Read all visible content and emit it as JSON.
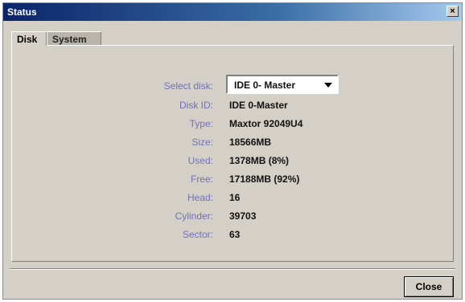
{
  "window": {
    "title": "Status"
  },
  "tabs": [
    {
      "label": "Disk",
      "active": true
    },
    {
      "label": "System",
      "active": false
    }
  ],
  "disk": {
    "select_label": "Select disk:",
    "selected_disk": "IDE 0- Master",
    "fields": [
      {
        "label": "Disk ID:",
        "value": "IDE 0-Master"
      },
      {
        "label": "Type:",
        "value": "Maxtor 92049U4"
      },
      {
        "label": "Size:",
        "value": "18566MB"
      },
      {
        "label": "Used:",
        "value": "1378MB (8%)"
      },
      {
        "label": "Free:",
        "value": "17188MB (92%)"
      },
      {
        "label": "Head:",
        "value": "16"
      },
      {
        "label": "Cylinder:",
        "value": "39703"
      },
      {
        "label": "Sector:",
        "value": "63"
      }
    ]
  },
  "buttons": {
    "close_label": "Close"
  },
  "colors": {
    "label": "#7070b8",
    "titlebar": "#0a246a",
    "window_bg": "#d4d0c8"
  }
}
